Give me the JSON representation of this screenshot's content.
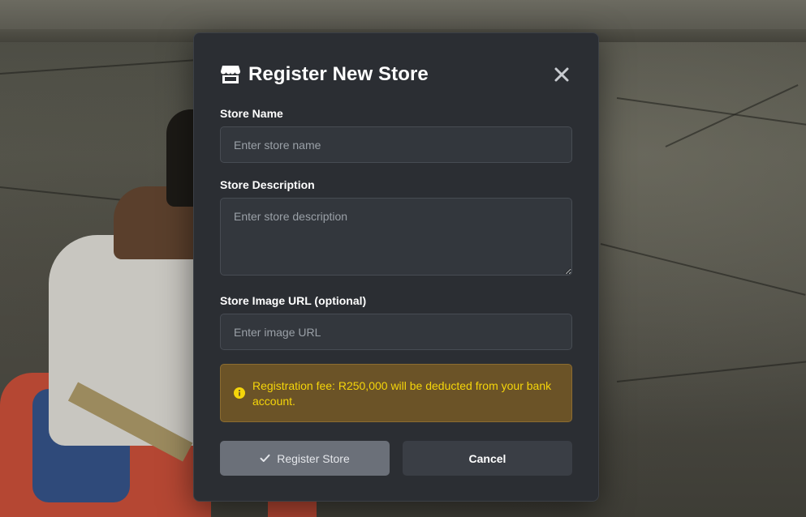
{
  "modal": {
    "title": "Register New Store",
    "title_icon": "store-icon",
    "close_icon": "close-icon"
  },
  "form": {
    "store_name": {
      "label": "Store Name",
      "value": "",
      "placeholder": "Enter store name"
    },
    "store_description": {
      "label": "Store Description",
      "value": "",
      "placeholder": "Enter store description"
    },
    "store_image_url": {
      "label": "Store Image URL (optional)",
      "value": "",
      "placeholder": "Enter image URL"
    }
  },
  "notice": {
    "icon": "info-icon",
    "text": "Registration fee: R250,000 will be deducted from your bank account.",
    "text_color": "#f5d50a",
    "background": "#6b5327"
  },
  "actions": {
    "register_label": "Register Store",
    "register_icon": "check-icon",
    "cancel_label": "Cancel"
  },
  "colors": {
    "modal_background": "#2b2e33",
    "input_background": "#33373d",
    "register_button": "#6b7079",
    "cancel_button": "#3a3e45"
  }
}
